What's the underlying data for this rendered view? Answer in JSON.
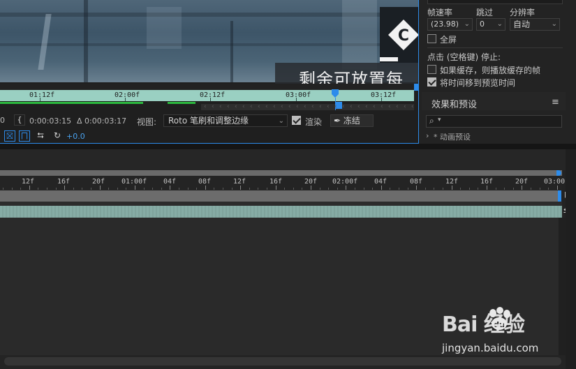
{
  "viewer": {
    "subtitle_text": "剩余可放置每",
    "ruler_labels": [
      "01:12f",
      "02:00f",
      "02:12f",
      "03:00f",
      "03:12f"
    ],
    "time_in": "0:00:03:15",
    "time_duration": "Δ 0:00:03:17",
    "view_label": "视图:",
    "view_value": "Roto 笔刷和调整边缘",
    "render_label": "渲染",
    "render_checked": true,
    "freeze_label": "冻结",
    "offset_value": "+0.0",
    "left_fragment": "0"
  },
  "preview": {
    "framerate_label": "帧速率",
    "skip_label": "跳过",
    "resolution_label": "分辨率",
    "framerate_value": "(23.98)",
    "skip_value": "0",
    "resolution_value": "自动",
    "fullscreen_label": "全屏",
    "fullscreen_checked": false,
    "stop_label": "点击 (空格键) 停止:",
    "cache_label": "如果缓存，则播放缓存的帧",
    "cache_checked": false,
    "move_time_label": "将时间移到预览时间",
    "move_time_checked": true
  },
  "effects": {
    "title": "效果和预设",
    "menu_icon": "hamburger-icon",
    "search_placeholder": "",
    "tree_item": "* 动画预设"
  },
  "timeline": {
    "ruler_labels": [
      "12f",
      "16f",
      "20f",
      "01:00f",
      "04f",
      "08f",
      "12f",
      "16f",
      "20f",
      "02:00f",
      "04f",
      "08f",
      "12f",
      "16f",
      "20f",
      "03:00"
    ]
  },
  "watermark": {
    "brand": "Bai  经验",
    "url": "jingyan.baidu.com"
  },
  "colors": {
    "accent": "#2d8ceb",
    "layer_bar": "#84aaa3",
    "viewer_bar": "#9ad0c2",
    "cache_green": "#2bb73e"
  }
}
